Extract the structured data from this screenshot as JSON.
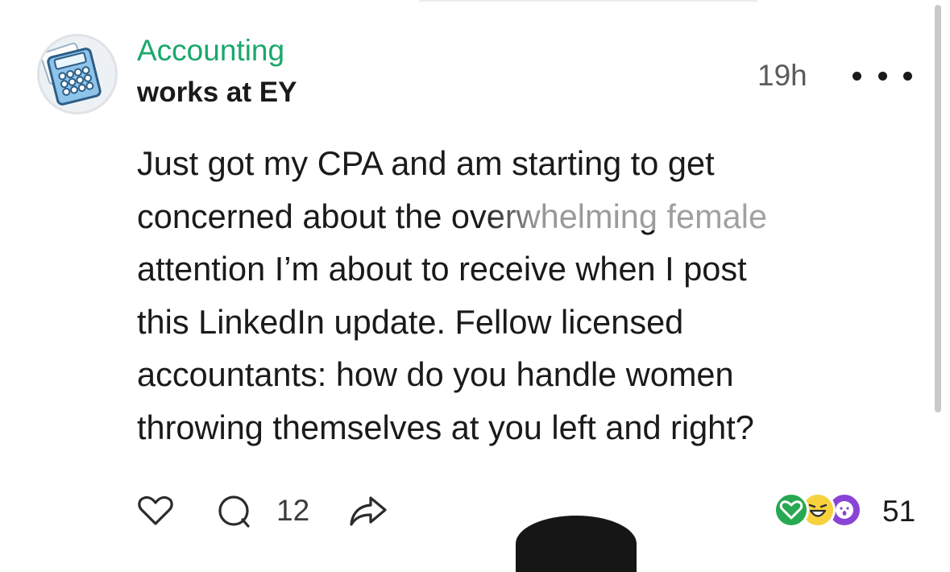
{
  "post": {
    "community": "Accounting",
    "author_employer": "works at EY",
    "timestamp": "19h",
    "avatar_icon": "calculator-icon",
    "more_icon": "more-dots-icon",
    "body_lines": [
      "Just got my CPA and am starting to get",
      "concerned about the overwhelming female",
      "attention I’m about to receive when I post",
      "this LinkedIn update. Fellow licensed",
      "accountants: how do you handle women",
      "throwing themselves at you left and right?"
    ]
  },
  "actions": {
    "like_icon": "heart-outline-icon",
    "comment_icon": "comment-bubble-icon",
    "comment_count": "12",
    "share_icon": "share-arrow-icon",
    "reaction_icons": [
      "heart-reaction-icon",
      "laugh-reaction-icon",
      "wow-reaction-icon"
    ],
    "reaction_count": "51"
  },
  "colors": {
    "community_green": "#1ba86b",
    "heart_reaction": "#27a852",
    "laugh_reaction": "#f7d23e",
    "wow_reaction": "#8a43d6"
  }
}
